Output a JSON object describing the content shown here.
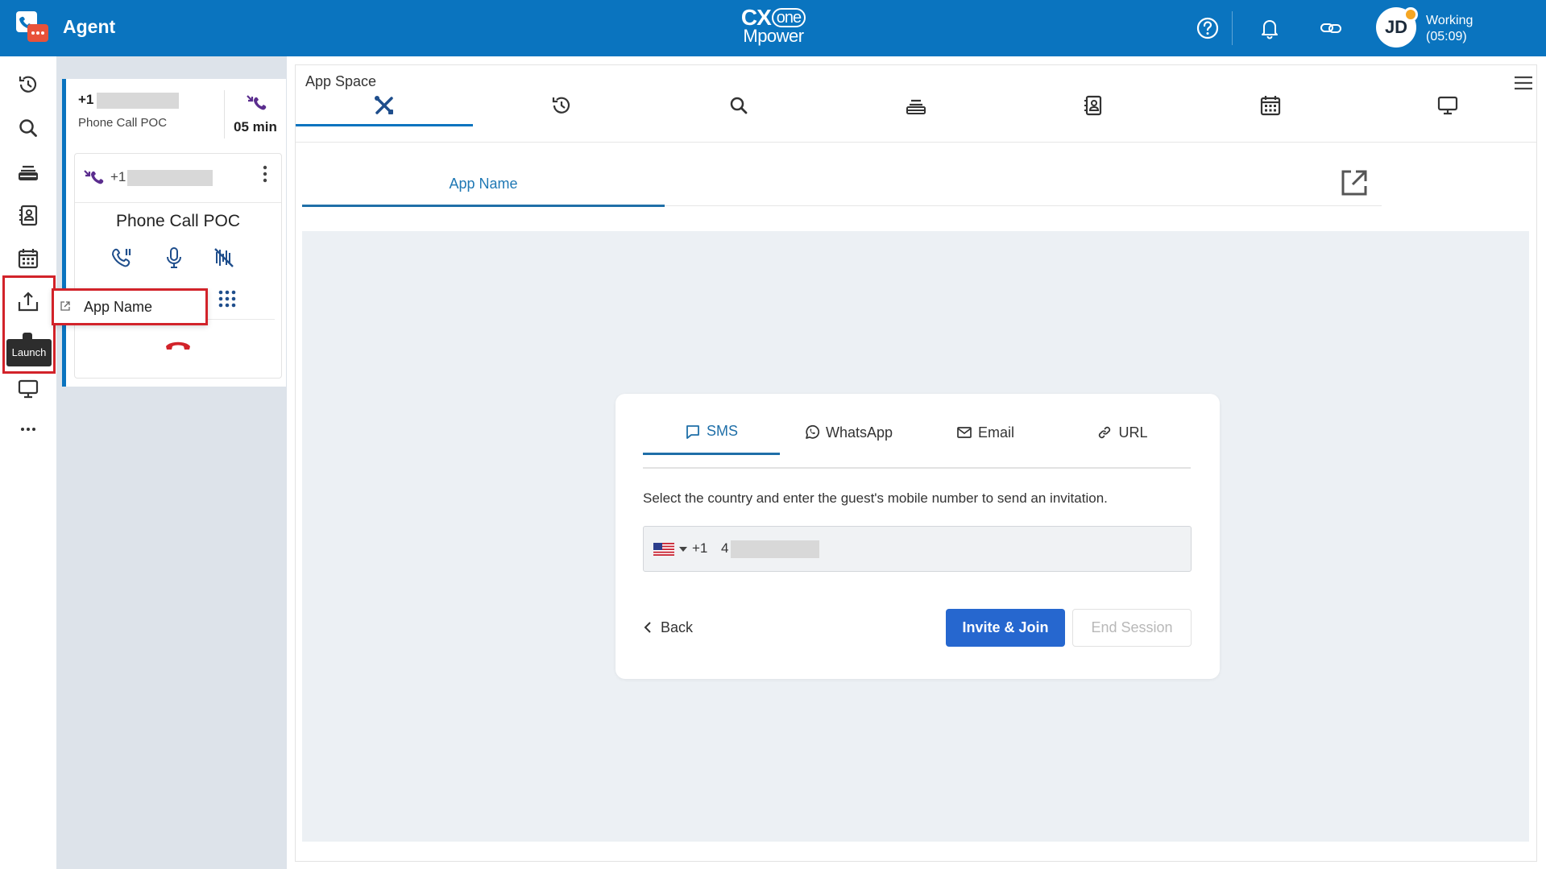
{
  "header": {
    "app_title": "Agent",
    "brand_line1": "CX",
    "brand_one": "one",
    "brand_line2": "Mpower",
    "avatar_initials": "JD",
    "status": "Working",
    "status_time": "(05:09)",
    "icons": [
      "agent-logo-icon",
      "help-icon",
      "bell-icon",
      "link-icon"
    ]
  },
  "leftnav": {
    "items": [
      "history-icon",
      "search-icon",
      "queue-icon",
      "contacts-icon",
      "calendar-icon",
      "launch-icon",
      "monitor-icon",
      "more-icon"
    ],
    "tooltip": "Launch"
  },
  "contact": {
    "number_prefix": "+1",
    "label": "Phone Call POC",
    "duration": "05 min",
    "inner_number_prefix": "+1",
    "title": "Phone Call POC",
    "controls": [
      "hold-icon",
      "mute-icon",
      "unmute-disabled-icon",
      "dialpad-icon",
      "hangup-icon"
    ]
  },
  "launch_menu": {
    "item_label": "App Name"
  },
  "appspace": {
    "title": "App Space",
    "tabs": [
      "tools-icon",
      "history-icon",
      "search-icon",
      "queue-icon",
      "contacts-icon",
      "calendar-icon",
      "monitor-icon"
    ],
    "subtab_label": "App Name",
    "invite": {
      "tabs": [
        {
          "label": "SMS",
          "icon": "sms-icon"
        },
        {
          "label": "WhatsApp",
          "icon": "whatsapp-icon"
        },
        {
          "label": "Email",
          "icon": "email-icon"
        },
        {
          "label": "URL",
          "icon": "link-icon"
        }
      ],
      "instruction": "Select the country and enter the guest's mobile number to send an invitation.",
      "dial_code": "+1",
      "phone_value": "4",
      "back_label": "Back",
      "invite_label": "Invite & Join",
      "end_label": "End Session"
    }
  },
  "colors": {
    "header": "#0a74bf",
    "accent": "#2667cf",
    "highlight": "#d2232a",
    "call_purple": "#5b2d8e",
    "hangup_red": "#d2232a"
  }
}
